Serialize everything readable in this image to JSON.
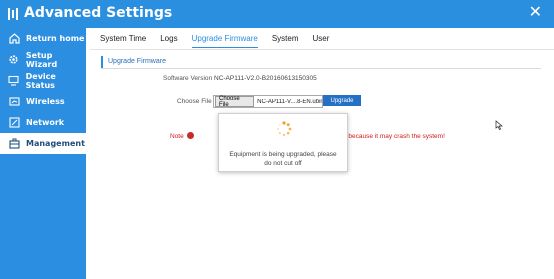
{
  "window": {
    "title": "Advanced Settings",
    "close_icon": "close-icon"
  },
  "sidebar": {
    "items": [
      {
        "label": "Return home",
        "icon": "home-icon"
      },
      {
        "label": "Setup Wizard",
        "icon": "gear-icon"
      },
      {
        "label": "Device Status",
        "icon": "monitor-icon"
      },
      {
        "label": "Wireless",
        "icon": "wifi-icon"
      },
      {
        "label": "Network",
        "icon": "network-icon"
      },
      {
        "label": "Management",
        "icon": "toolbox-icon",
        "active": true
      }
    ]
  },
  "tabs": [
    {
      "label": "System Time"
    },
    {
      "label": "Logs"
    },
    {
      "label": "Upgrade Firmware",
      "active": true
    },
    {
      "label": "System"
    },
    {
      "label": "User"
    }
  ],
  "section": {
    "title": "Upgrade Firmware"
  },
  "form": {
    "software_version_label": "Software Version",
    "software_version_value": "NC-AP111-V2.0-B20160613150305",
    "choose_file_label": "Choose File",
    "choose_file_button": "Choose File",
    "file_name": "NC-AP111-V....8-EN.ubin",
    "upgrade_button": "Upgrade",
    "note_label": "Note",
    "note_text": "d because it may crash the system!"
  },
  "modal": {
    "message": "Equipment is being upgraded, please do not cut off"
  },
  "colors": {
    "accent": "#2b8fe0",
    "sidebar": "#2c8ee0",
    "note": "#d21a1a",
    "button": "#2370c4",
    "spinner": "#f0a020"
  }
}
